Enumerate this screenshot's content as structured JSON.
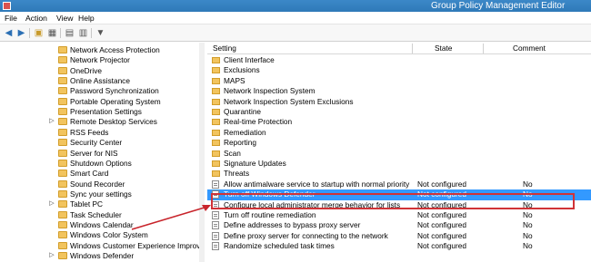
{
  "window": {
    "title": "Group Policy Management Editor"
  },
  "menu": [
    "File",
    "Action",
    "View",
    "Help"
  ],
  "tree": {
    "items": [
      {
        "label": "Network Access Protection",
        "expander": ""
      },
      {
        "label": "Network Projector",
        "expander": ""
      },
      {
        "label": "OneDrive",
        "expander": ""
      },
      {
        "label": "Online Assistance",
        "expander": ""
      },
      {
        "label": "Password Synchronization",
        "expander": ""
      },
      {
        "label": "Portable Operating System",
        "expander": ""
      },
      {
        "label": "Presentation Settings",
        "expander": ""
      },
      {
        "label": "Remote Desktop Services",
        "expander": "▷"
      },
      {
        "label": "RSS Feeds",
        "expander": ""
      },
      {
        "label": "Security Center",
        "expander": ""
      },
      {
        "label": "Server for NIS",
        "expander": ""
      },
      {
        "label": "Shutdown Options",
        "expander": ""
      },
      {
        "label": "Smart Card",
        "expander": ""
      },
      {
        "label": "Sound Recorder",
        "expander": ""
      },
      {
        "label": "Sync your settings",
        "expander": ""
      },
      {
        "label": "Tablet PC",
        "expander": "▷"
      },
      {
        "label": "Task Scheduler",
        "expander": ""
      },
      {
        "label": "Windows Calendar",
        "expander": ""
      },
      {
        "label": "Windows Color System",
        "expander": ""
      },
      {
        "label": "Windows Customer Experience Improvem",
        "expander": ""
      },
      {
        "label": "Windows Defender",
        "expander": "▷"
      }
    ]
  },
  "list": {
    "columns": {
      "setting": "Setting",
      "state": "State",
      "comment": "Comment"
    },
    "folders": [
      "Client Interface",
      "Exclusions",
      "MAPS",
      "Network Inspection System",
      "Network Inspection System Exclusions",
      "Quarantine",
      "Real-time Protection",
      "Remediation",
      "Reporting",
      "Scan",
      "Signature Updates",
      "Threats"
    ],
    "policies": [
      {
        "name": "Allow antimalware service to startup with normal priority",
        "state": "Not configured",
        "comment": "No"
      },
      {
        "name": "Turn off Windows Defender",
        "state": "Not configured",
        "comment": "No"
      },
      {
        "name": "Configure local administrator merge behavior for lists",
        "state": "Not configured",
        "comment": "No"
      },
      {
        "name": "Turn off routine remediation",
        "state": "Not configured",
        "comment": "No"
      },
      {
        "name": "Define addresses to bypass proxy server",
        "state": "Not configured",
        "comment": "No"
      },
      {
        "name": "Define proxy server for connecting to the network",
        "state": "Not configured",
        "comment": "No"
      },
      {
        "name": "Randomize scheduled task times",
        "state": "Not configured",
        "comment": "No"
      }
    ]
  },
  "colors": {
    "selection": "#3399ff",
    "highlight": "#d03337"
  }
}
